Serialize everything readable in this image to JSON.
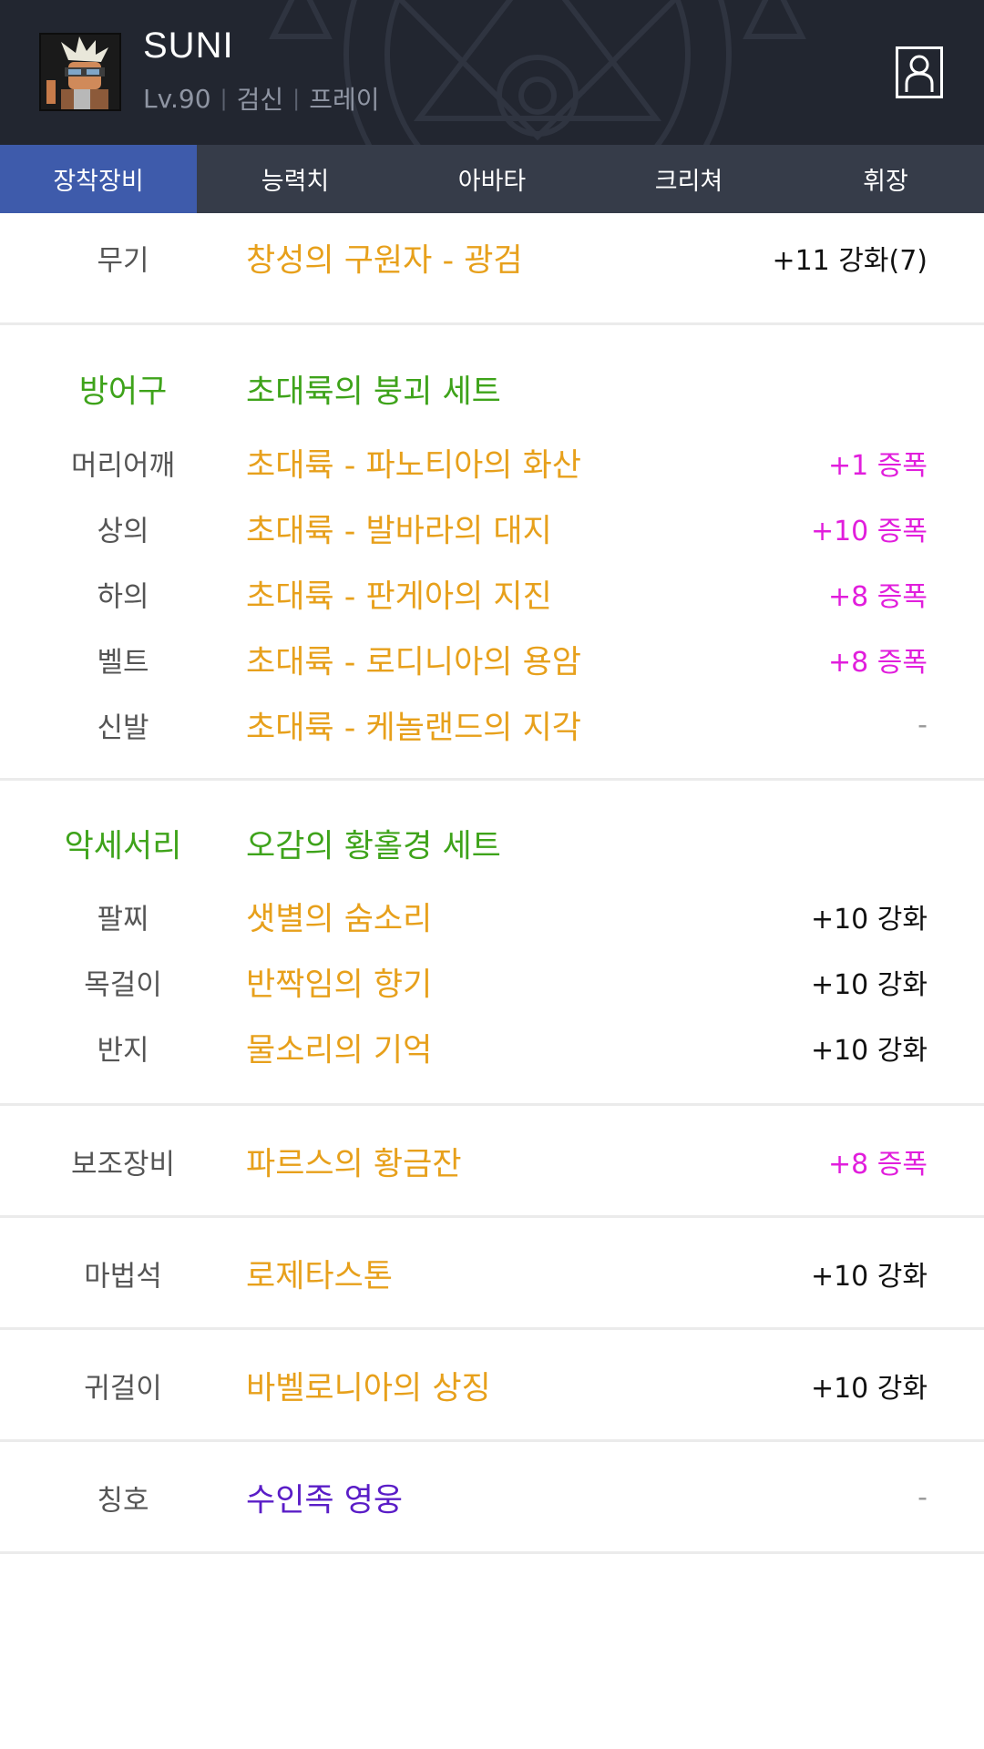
{
  "header": {
    "name": "SUNI",
    "level": "Lv.90",
    "job": "검신",
    "server": "프레이",
    "separator": "|"
  },
  "tabs": [
    {
      "label": "장착장비",
      "active": true
    },
    {
      "label": "능력치",
      "active": false
    },
    {
      "label": "아바타",
      "active": false
    },
    {
      "label": "크리쳐",
      "active": false
    },
    {
      "label": "휘장",
      "active": false
    }
  ],
  "weapon": {
    "label": "무기",
    "item": "창성의 구원자 - 광검",
    "value": "+11 강화(7)"
  },
  "armor": {
    "header": {
      "label": "방어구",
      "item": "초대륙의 붕괴 세트"
    },
    "rows": [
      {
        "label": "머리어깨",
        "item": "초대륙 - 파노티아의 화산",
        "value": "+1 증폭"
      },
      {
        "label": "상의",
        "item": "초대륙 - 발바라의 대지",
        "value": "+10 증폭"
      },
      {
        "label": "하의",
        "item": "초대륙 - 판게아의 지진",
        "value": "+8 증폭"
      },
      {
        "label": "벨트",
        "item": "초대륙 - 로디니아의 용암",
        "value": "+8 증폭"
      },
      {
        "label": "신발",
        "item": "초대륙 - 케놀랜드의 지각",
        "value": "-"
      }
    ]
  },
  "accessory": {
    "header": {
      "label": "악세서리",
      "item": "오감의 황홀경 세트"
    },
    "rows": [
      {
        "label": "팔찌",
        "item": "샛별의 숨소리",
        "value": "+10 강화"
      },
      {
        "label": "목걸이",
        "item": "반짝임의 향기",
        "value": "+10 강화"
      },
      {
        "label": "반지",
        "item": "물소리의 기억",
        "value": "+10 강화"
      }
    ]
  },
  "sub_equip": {
    "label": "보조장비",
    "item": "파르스의 황금잔",
    "value": "+8 증폭"
  },
  "magic_stone": {
    "label": "마법석",
    "item": "로제타스톤",
    "value": "+10 강화"
  },
  "earring": {
    "label": "귀걸이",
    "item": "바벨로니아의 상징",
    "value": "+10 강화"
  },
  "title": {
    "label": "칭호",
    "item": "수인족 영웅",
    "value": "-"
  },
  "colors": {
    "header_bg": "#222630",
    "tab_bg": "#363c49",
    "tab_active": "#3e5bab",
    "item_epic": "#e7a01b",
    "set_green": "#3ea31a",
    "amplify": "#e11edc",
    "title_purple": "#5a1dc7"
  },
  "icons": [
    "character-avatar",
    "profile-icon"
  ]
}
